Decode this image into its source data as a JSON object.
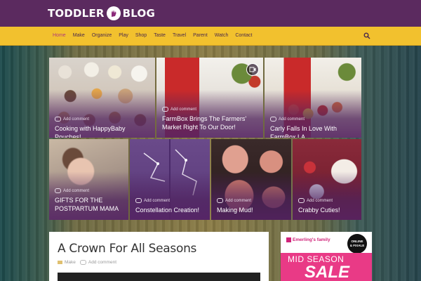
{
  "site": {
    "logo_left": "TODDLER",
    "logo_right": "BLOG"
  },
  "nav": {
    "items": [
      {
        "label": "Home",
        "active": true
      },
      {
        "label": "Make"
      },
      {
        "label": "Organize"
      },
      {
        "label": "Play"
      },
      {
        "label": "Shop"
      },
      {
        "label": "Taste"
      },
      {
        "label": "Travel"
      },
      {
        "label": "Parent"
      },
      {
        "label": "Watch"
      },
      {
        "label": "Contact"
      }
    ],
    "search_icon": "search-icon"
  },
  "featured": [
    {
      "title": "Cooking with HappyBaby Pouches!",
      "comment": "Add comment"
    },
    {
      "title": "FarmBox Brings The Farmers' Market Right To Our Door!",
      "comment": "Add comment",
      "video": true
    },
    {
      "title": "Carly Falls In Love With FarmBox LA",
      "comment": "Add comment"
    },
    {
      "title_line1": "GIFTS FOR THE",
      "title_line2": "POSTPARTUM MAMA",
      "comment": "Add comment"
    },
    {
      "title": "Constellation Creation!",
      "comment": "Add comment"
    },
    {
      "title": "Making Mud!",
      "comment": "Add comment"
    },
    {
      "title": "Crabby Cuties!",
      "comment": "Add comment"
    }
  ],
  "post": {
    "title": "A Crown For All Seasons",
    "category": "Make",
    "comment": "Add comment"
  },
  "ad": {
    "brand": "Emerling's family",
    "badge_line1": "ONLINE",
    "badge_line2": "& FIXALE",
    "line1": "MID SEASON",
    "line2": "SALE"
  },
  "colors": {
    "topbar": "#5b2a5f",
    "navbar": "#f2c12e",
    "tile_overlay": "#5a2364",
    "ad_pink": "#e93a86"
  }
}
